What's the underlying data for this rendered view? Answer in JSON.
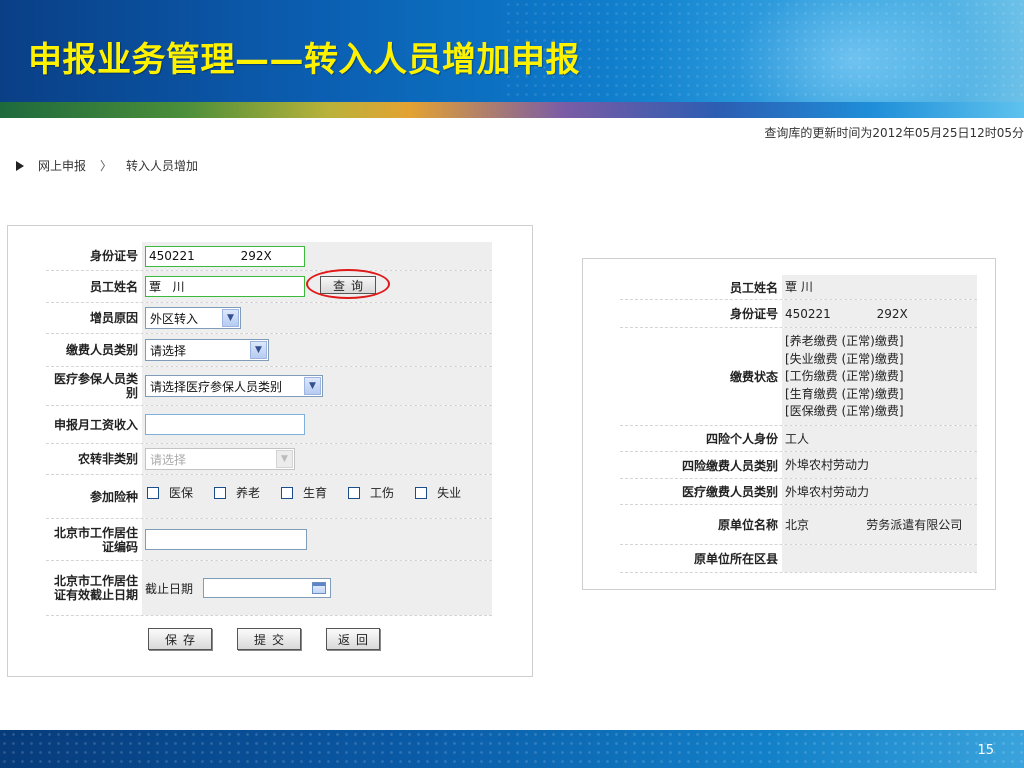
{
  "slide": {
    "title": "申报业务管理——转入人员增加申报",
    "page_number": "15"
  },
  "update_time": "查询库的更新时间为2012年05月25日12时05分",
  "breadcrumb": {
    "items": [
      "网上申报",
      "转入人员增加"
    ],
    "separator": "〉"
  },
  "form": {
    "id_label": "身份证号",
    "id_value": "450221            292X",
    "name_label": "员工姓名",
    "name_value": "覃   川",
    "query_button": "查询",
    "reason_label": "增员原因",
    "reason_value": "外区转入",
    "payer_type_label": "缴费人员类别",
    "payer_type_value": "请选择",
    "medical_type_label": "医疗参保人员类别",
    "medical_type_value": "请选择医疗参保人员类别",
    "salary_label": "申报月工资收入",
    "salary_value": "",
    "agri_label": "农转非类别",
    "agri_value": "请选择",
    "insurance_label": "参加险种",
    "insurance_options": [
      "医保",
      "养老",
      "生育",
      "工伤",
      "失业"
    ],
    "work_permit_label": "北京市工作居住证编码",
    "work_permit_value": "",
    "expiry_label": "北京市工作居住证有效截止日期",
    "expiry_prefix": "截止日期",
    "expiry_value": "",
    "save_button": "保存",
    "submit_button": "提交",
    "back_button": "返回"
  },
  "info": {
    "name_label": "员工姓名",
    "name_value": "覃   川",
    "id_label": "身份证号",
    "id_value": "450221            292X",
    "status_label": "缴费状态",
    "status_values": [
      "[养老缴费 (正常)缴费]",
      "[失业缴费 (正常)缴费]",
      "[工伤缴费 (正常)缴费]",
      "[生育缴费 (正常)缴费]",
      "[医保缴费 (正常)缴费]"
    ],
    "identity_label": "四险个人身份",
    "identity_value": "工人",
    "four_type_label": "四险缴费人员类别",
    "four_type_value": "外埠农村劳动力",
    "medical_type_label": "医疗缴费人员类别",
    "medical_type_value": "外埠农村劳动力",
    "orig_company_label": "原单位名称",
    "orig_company_value": "北京               劳务派遣有限公司",
    "orig_district_label": "原单位所在区县",
    "orig_district_value": ""
  }
}
